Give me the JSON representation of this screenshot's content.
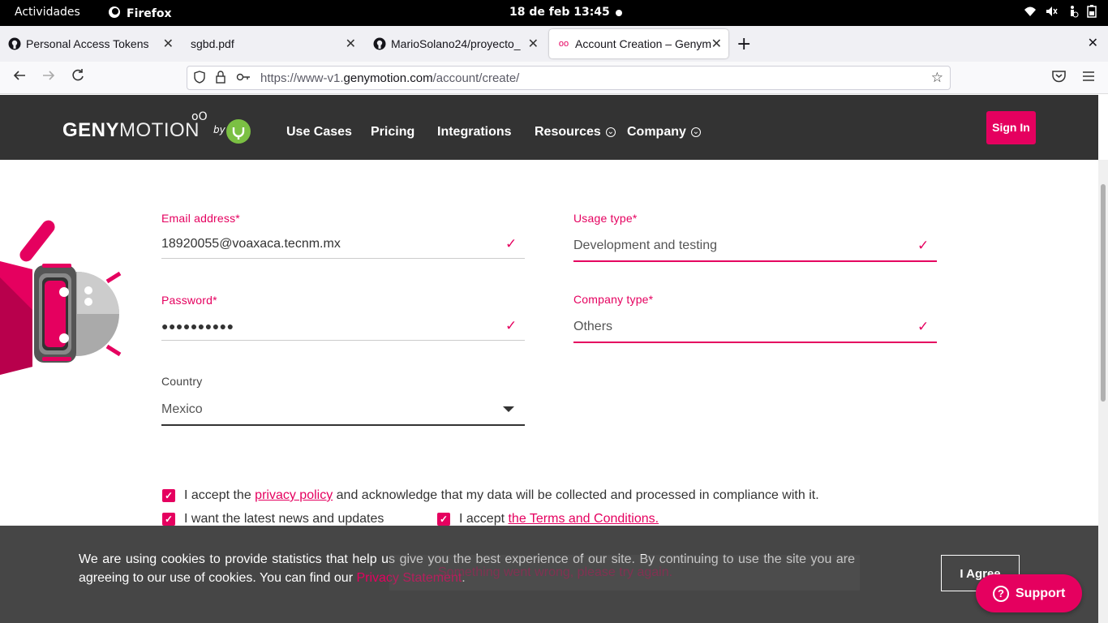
{
  "os_bar": {
    "activities": "Actividades",
    "app_name": "Firefox",
    "clock": "18 de feb  13:45"
  },
  "browser": {
    "tabs": [
      {
        "title": "Personal Access Tokens",
        "icon": "github-icon"
      },
      {
        "title": "sgbd.pdf",
        "icon": "pdf-icon"
      },
      {
        "title": "MarioSolano24/proyecto_",
        "icon": "github-icon"
      },
      {
        "title": "Account Creation – Genym",
        "icon": "genymotion-icon",
        "active": true
      }
    ],
    "url_prefix": "https://www-v1.",
    "url_domain": "genymotion.com",
    "url_path": "/account/create/"
  },
  "site": {
    "logo_bold": "GENY",
    "logo_thin": "MOTION",
    "logo_by": "by",
    "nav": [
      {
        "label": "Use Cases"
      },
      {
        "label": "Pricing"
      },
      {
        "label": "Integrations"
      },
      {
        "label": "Resources"
      },
      {
        "label": "Company"
      }
    ],
    "signin": "Sign In",
    "accent": "#e5005f"
  },
  "form": {
    "email": {
      "label": "Email address*",
      "value": "18920055@voaxaca.tecnm.mx"
    },
    "password": {
      "label": "Password*",
      "value": "●●●●●●●●●●"
    },
    "country": {
      "label": "Country",
      "value": "Mexico"
    },
    "usage": {
      "label": "Usage type*",
      "value": "Development and testing"
    },
    "company": {
      "label": "Company type*",
      "value": "Others"
    },
    "privacy_pre": "I accept the ",
    "privacy_link": "privacy policy",
    "privacy_post": " and acknowledge that my data will be collected and processed in compliance with it.",
    "news": "I want the latest news and updates",
    "terms_pre": "I accept ",
    "terms_link": "the Terms and Conditions."
  },
  "cookie": {
    "text": "We are using cookies to provide statistics that help us give you the best experience of our site. By continuing to use the site you are agreeing to our use of cookies. You can find our ",
    "link": "Privacy Statement",
    "end": ".",
    "agree": "I Agree",
    "error_behind": "Something went wrong, please try again."
  },
  "support": {
    "label": "Support"
  }
}
